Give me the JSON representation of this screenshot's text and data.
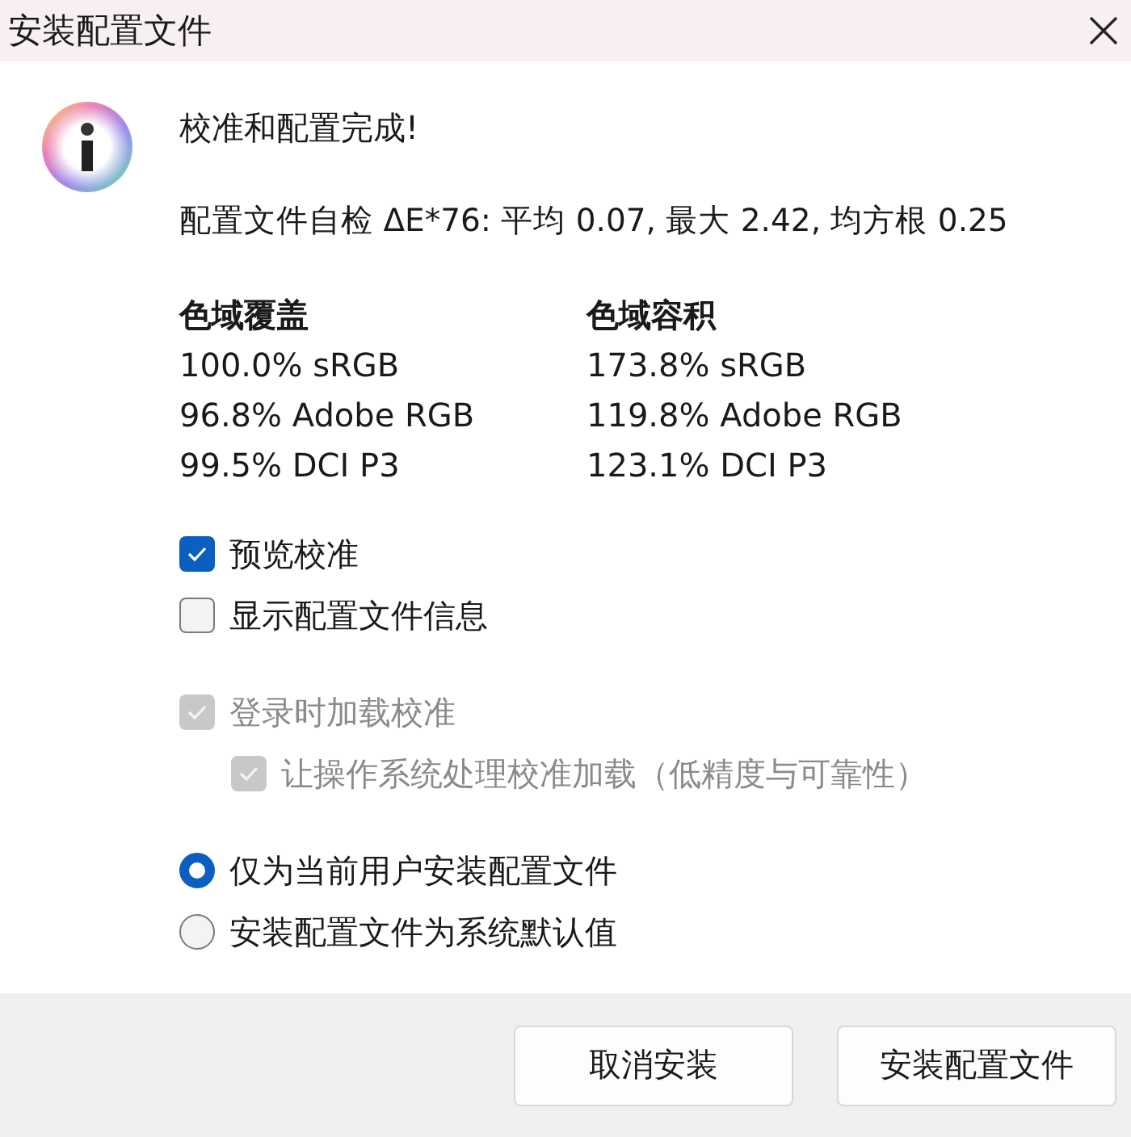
{
  "window": {
    "title": "安装配置文件"
  },
  "message": {
    "heading": "校准和配置完成!",
    "self_check": "配置文件自检 ΔE*76: 平均 0.07, 最大 2.42, 均方根 0.25"
  },
  "gamut_columns": [
    {
      "heading": "色域覆盖",
      "lines": [
        "100.0% sRGB",
        "96.8% Adobe RGB",
        "99.5% DCI P3"
      ]
    },
    {
      "heading": "色域容积",
      "lines": [
        "173.8% sRGB",
        "119.8% Adobe RGB",
        "123.1% DCI P3"
      ]
    }
  ],
  "option_groups": [
    [
      {
        "label": "预览校准",
        "checked": true,
        "disabled": false
      },
      {
        "label": "显示配置文件信息",
        "checked": false,
        "disabled": false
      }
    ],
    [
      {
        "label": "登录时加载校准",
        "checked": true,
        "disabled": true,
        "children": [
          {
            "label": "让操作系统处理校准加载（低精度与可靠性）",
            "checked": true,
            "disabled": true
          }
        ]
      }
    ]
  ],
  "install_scope": [
    {
      "label": "仅为当前用户安装配置文件",
      "selected": true
    },
    {
      "label": "安装配置文件为系统默认值",
      "selected": false
    }
  ],
  "buttons": [
    "取消安装",
    "安装配置文件"
  ]
}
